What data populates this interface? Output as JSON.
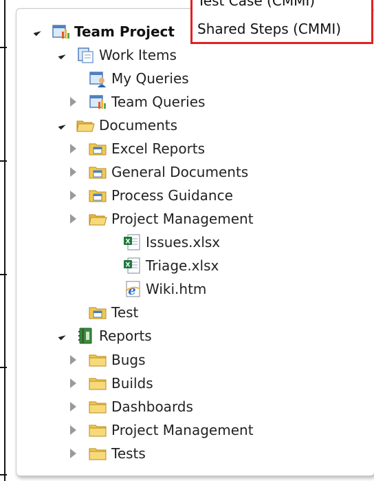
{
  "popup": {
    "options": [
      "Test Case (CMMI)",
      "Shared Steps (CMMI)"
    ]
  },
  "tree": {
    "team_project": "Team Project",
    "work_items": "Work Items",
    "my_queries": "My Queries",
    "team_queries": "Team Queries",
    "documents": "Documents",
    "excel_reports": "Excel Reports",
    "general_documents": "General Documents",
    "process_guidance": "Process Guidance",
    "project_management": "Project Management",
    "issues_file": "Issues.xlsx",
    "triage_file": "Triage.xlsx",
    "wiki_file": "Wiki.htm",
    "test": "Test",
    "reports": "Reports",
    "bugs": "Bugs",
    "builds": "Builds",
    "dashboards": "Dashboards",
    "reports_project_management": "Project Management",
    "tests": "Tests"
  },
  "colors": {
    "popup_border": "#e02020",
    "folder": "#f2c94c",
    "excel": "#1e7a3c"
  }
}
